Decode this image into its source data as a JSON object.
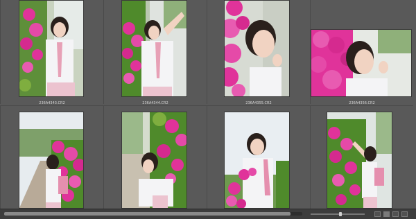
{
  "grid": {
    "items": [
      {
        "filename": "236A4343.CR2",
        "scene": "portrait-flowers-left"
      },
      {
        "filename": "236A4344.CR2",
        "scene": "portrait-flowers-left-saluting"
      },
      {
        "filename": "236A4355.CR2",
        "scene": "closeup-flowers-left"
      },
      {
        "filename": "236A4356.CR2",
        "scene": "landscape-closeup-flowers"
      },
      {
        "filename": "",
        "scene": "portrait-path-hedge"
      },
      {
        "filename": "",
        "scene": "portrait-sitting-flowers"
      },
      {
        "filename": "",
        "scene": "portrait-sky-flowers"
      },
      {
        "filename": "",
        "scene": "portrait-reaching-hedge"
      }
    ]
  },
  "statusbar": {
    "scroll_fraction": 0.0,
    "scroll_visible_fraction": 0.96,
    "zoom_fraction": 0.55
  },
  "colors": {
    "background": "#595959",
    "flower_pink": "#e0339a",
    "foliage": "#4f8a2b",
    "sky": "#e9eef2"
  }
}
